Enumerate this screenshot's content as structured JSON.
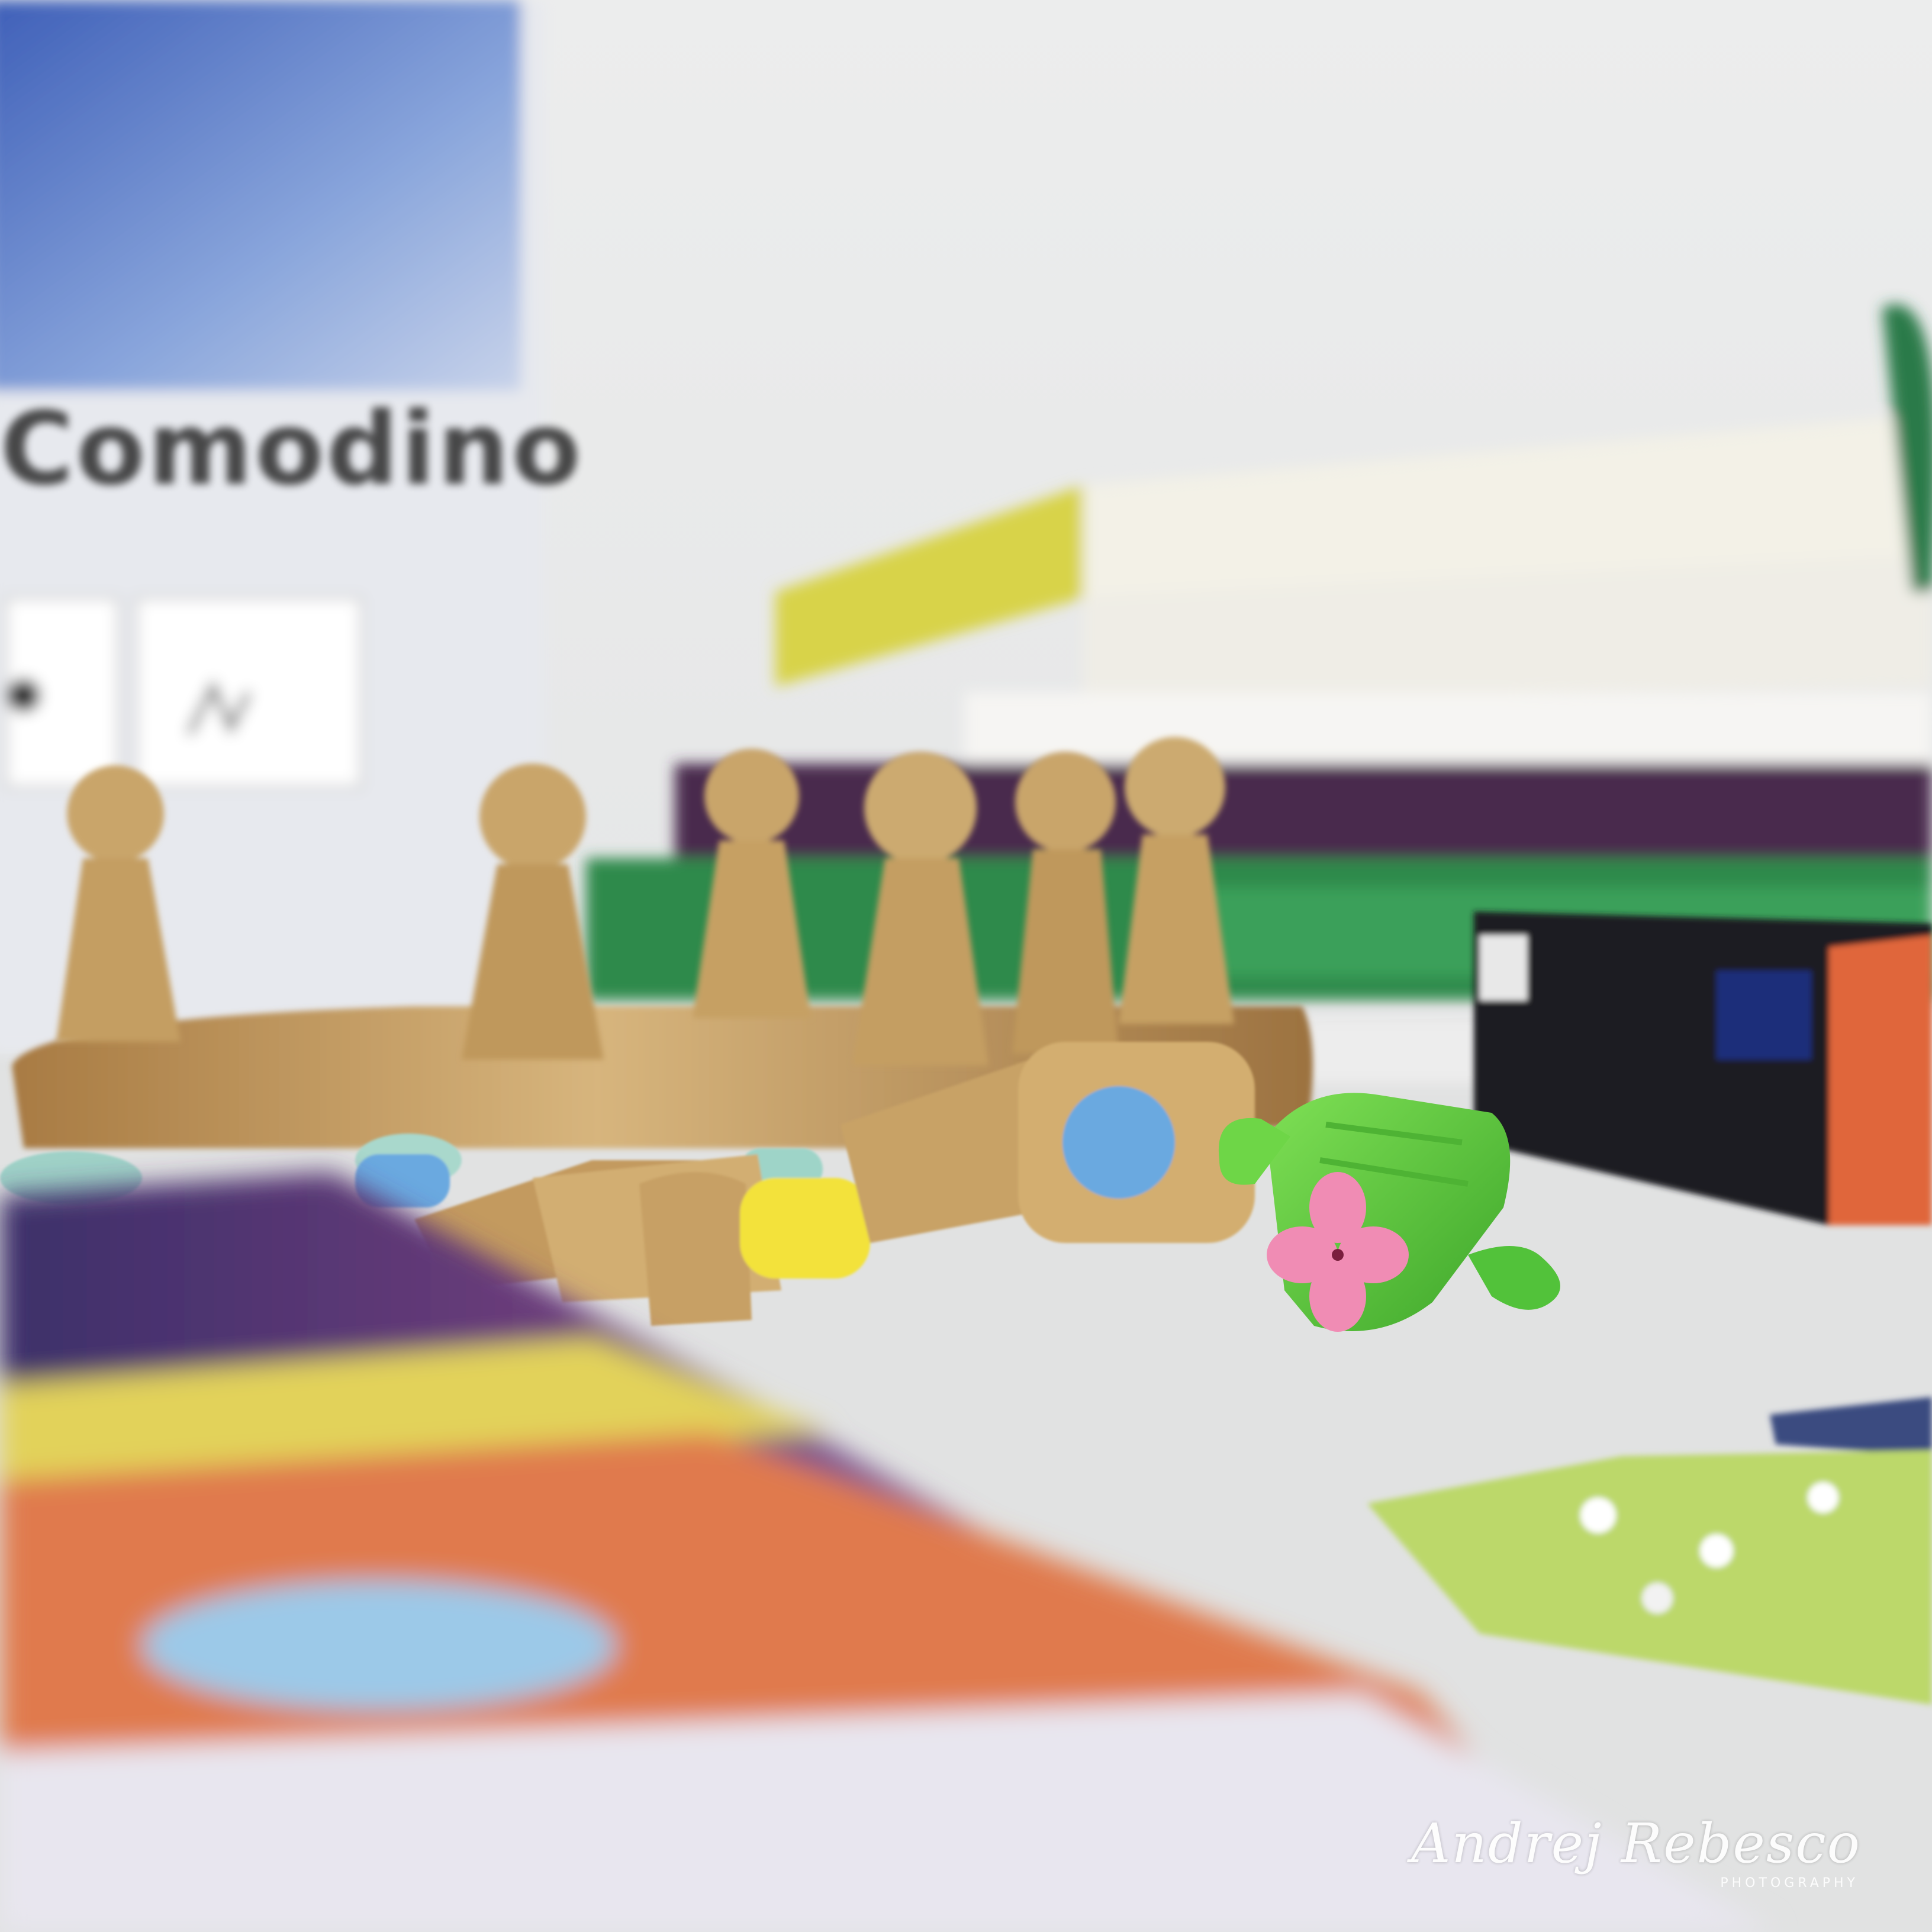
{
  "scene": {
    "box_title": "Comodino",
    "watermark": {
      "signature": "Andrej Rebesco",
      "subtitle": "PHOTOGRAPHY"
    }
  },
  "colors": {
    "wall": "#e9eaeb",
    "table": "#e3e4e4",
    "wood": "#c9a56b",
    "wood_dark": "#9a7440",
    "cactus": "#5fcf3c",
    "flower": "#f08cb4",
    "peg_blue": "#6aa9e0",
    "peg_yellow": "#f3e23a",
    "book_yellow": "#d8d44a",
    "book_green": "#2f8a4b",
    "book_purple": "#4a2a4e",
    "box_orange": "#e0663a"
  }
}
